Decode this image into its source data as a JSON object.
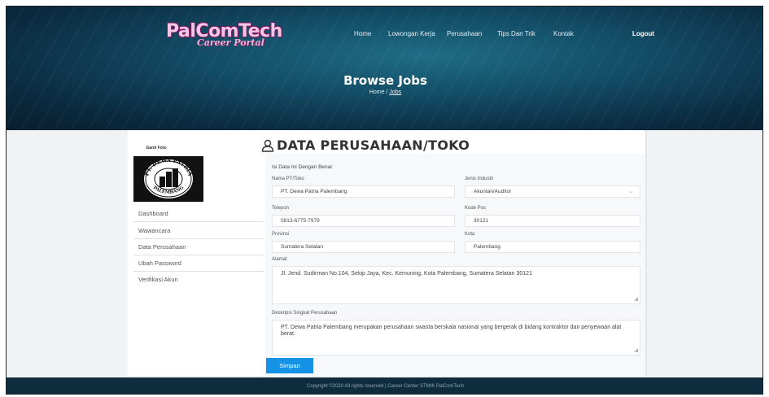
{
  "header": {
    "logo_main": "PalComTech",
    "logo_sub": "Career Portal",
    "nav": [
      "Home",
      "Lowongan Kerja",
      "Perusahaan",
      "Tips Dan Trik",
      "Kontak"
    ],
    "logout": "Logout"
  },
  "hero": {
    "title": "Browse Jobs",
    "breadcrumb_home": "Home",
    "breadcrumb_sep": "/",
    "breadcrumb_current": "Jobs"
  },
  "page": {
    "heading": "DATA PERUSAHAAN/TOKO"
  },
  "sidebar": {
    "foto_label": "Ganti Foto",
    "logo_text_top": "PT. DEWA PATRIA",
    "logo_text_bottom": "PALEMBANG",
    "items": [
      "Dashboard",
      "Wawancara",
      "Data Perusahaan",
      "Ubah Password",
      "Verifikasi Akun"
    ]
  },
  "form": {
    "note": "Isi Data Ini Dengan Benar",
    "nama_label": "Nama PT/Toko",
    "nama_value": "PT. Dewa Patria Palembang",
    "jenis_label": "Jenis Industri",
    "jenis_value": "Akuntan/Auditor",
    "telepon_label": "Telepon",
    "telepon_value": "0813-6775-7979",
    "kodepos_label": "Kode Pos",
    "kodepos_value": "30121",
    "provinsi_label": "Provinsi",
    "provinsi_value": "Sumatera Selatan",
    "kota_label": "Kota",
    "kota_value": "Palembang",
    "alamat_label": "Alamat",
    "alamat_value": "Jl. Jend. Sudirman No.104, Sekip Jaya, Kec. Kemuning, Kota Palembang, Sumatera Selatan 30121",
    "deskripsi_label": "Deskripsi Singkat Perusahaan",
    "deskripsi_value": "PT. Dewa Patria Palembang merupakan perusahaan swasta berskala nasional yang bergerak di bidang kontraktor dan penyewaan alat berat.",
    "submit": "Simpan"
  },
  "footer": {
    "text": "Copyright ©2020 All rights reserved | Career Center STMIK PalComTech"
  },
  "colors": {
    "primary_button": "#1493e6",
    "logo_pink": "#f4c7e8",
    "footer_bg": "#0f2c3e"
  }
}
